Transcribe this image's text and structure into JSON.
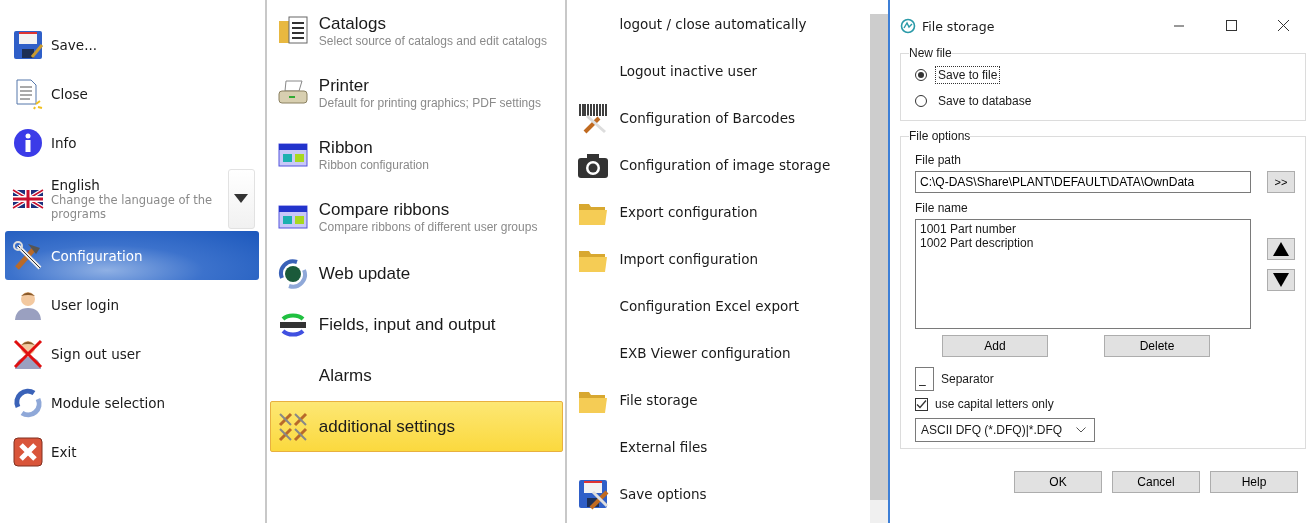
{
  "main_menu": {
    "items": [
      {
        "label": "Save...",
        "kind": "command",
        "selected": false
      },
      {
        "label": "Close",
        "kind": "command",
        "selected": false
      },
      {
        "label": "Info",
        "kind": "command",
        "selected": false
      },
      {
        "label": "English",
        "description": "Change the language of the programs",
        "kind": "language",
        "selected": false
      },
      {
        "label": "Configuration",
        "kind": "command",
        "selected": true
      },
      {
        "label": "User login",
        "kind": "command",
        "selected": false
      },
      {
        "label": "Sign out user",
        "kind": "command",
        "selected": false
      },
      {
        "label": "Module selection",
        "kind": "command",
        "selected": false
      },
      {
        "label": "Exit",
        "kind": "command",
        "selected": false
      }
    ]
  },
  "categories": {
    "items": [
      {
        "label": "Catalogs",
        "description": "Select source of catalogs and edit catalogs",
        "selected": false
      },
      {
        "label": "Printer",
        "description": "Default for printing graphics; PDF settings",
        "selected": false
      },
      {
        "label": "Ribbon",
        "description": "Ribbon configuration",
        "selected": false
      },
      {
        "label": "Compare ribbons",
        "description": "Compare ribbons of different user groups",
        "selected": false
      },
      {
        "label": "Web update",
        "selected": false
      },
      {
        "label": "Fields, input and output",
        "selected": false
      },
      {
        "label": "Alarms",
        "selected": false
      },
      {
        "label": "additional settings",
        "selected": true
      }
    ]
  },
  "settings": {
    "items": [
      {
        "label": "logout / close automatically"
      },
      {
        "label": "Logout inactive user"
      },
      {
        "label": "Configuration of Barcodes"
      },
      {
        "label": "Configuration of image storage"
      },
      {
        "label": "Export configuration"
      },
      {
        "label": "Import configuration"
      },
      {
        "label": "Configuration Excel export"
      },
      {
        "label": "EXB Viewer configuration"
      },
      {
        "label": "File storage"
      },
      {
        "label": "External files"
      },
      {
        "label": "Save options"
      }
    ]
  },
  "dialog": {
    "title": "File storage",
    "new_file": {
      "title": "New file",
      "options": [
        {
          "label": "Save to file",
          "selected": true,
          "focused": true
        },
        {
          "label": "Save to database",
          "selected": false,
          "focused": false
        }
      ]
    },
    "file_options": {
      "title": "File options",
      "path_label": "File path",
      "path_value": "C:\\Q-DAS\\Share\\PLANT\\DEFAULT\\DATA\\OwnData",
      "browse_button": ">>",
      "name_label": "File name",
      "name_list": [
        "1001 Part number",
        "1002 Part description"
      ],
      "add_button": "Add",
      "delete_button": "Delete",
      "separator_value": "_",
      "separator_label": "Separator",
      "capitals": {
        "label": "use capital letters only",
        "checked": true
      },
      "format_value": "ASCII DFQ (*.DFQ)|*.DFQ"
    },
    "buttons": [
      "OK",
      "Cancel",
      "Help"
    ]
  }
}
